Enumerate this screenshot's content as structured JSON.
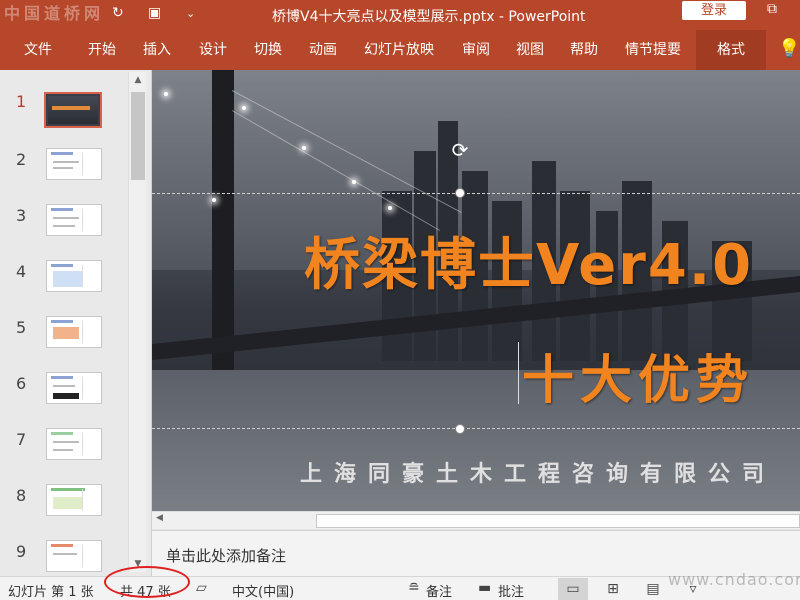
{
  "titlebar": {
    "watermark": "中国道桥网",
    "document_title": "桥博V4十大亮点以及模型展示.pptx  -  PowerPoint",
    "login_label": "登录",
    "save_icon": "save-icon",
    "undo_icon": "undo-icon",
    "redo_icon": "redo-icon",
    "present_icon": "present-icon",
    "customize_icon": "customize-icon",
    "restore_icon": "restore-icon"
  },
  "ribbon": {
    "tabs": [
      {
        "label": "文件"
      },
      {
        "label": "开始"
      },
      {
        "label": "插入"
      },
      {
        "label": "设计"
      },
      {
        "label": "切换"
      },
      {
        "label": "动画"
      },
      {
        "label": "幻灯片放映"
      },
      {
        "label": "审阅"
      },
      {
        "label": "视图"
      },
      {
        "label": "帮助"
      },
      {
        "label": "情节提要"
      },
      {
        "label": "格式"
      }
    ],
    "active_tab": "格式",
    "tell_me_icon": "lightbulb-icon"
  },
  "thumbnails": {
    "selected": 1,
    "items": [
      {
        "num": "1"
      },
      {
        "num": "2"
      },
      {
        "num": "3"
      },
      {
        "num": "4"
      },
      {
        "num": "5"
      },
      {
        "num": "6"
      },
      {
        "num": "7"
      },
      {
        "num": "8"
      },
      {
        "num": "9"
      }
    ]
  },
  "slide": {
    "title": "桥梁博士Ver4.0",
    "subtitle": "十大优势",
    "company": "上海同豪土木工程咨询有限公司",
    "rotate_icon": "rotate-icon"
  },
  "notes": {
    "placeholder": "单击此处添加备注"
  },
  "statusbar": {
    "slide_info": "幻灯片 第 1 张",
    "total": "共 47 张",
    "language": "中文(中国)",
    "notes_label": "备注",
    "comments_label": "批注",
    "watermark": "www.cndao.com"
  },
  "colors": {
    "brand": "#b7472a",
    "title_orange": "#f2841f",
    "highlight_red": "#e02020"
  }
}
